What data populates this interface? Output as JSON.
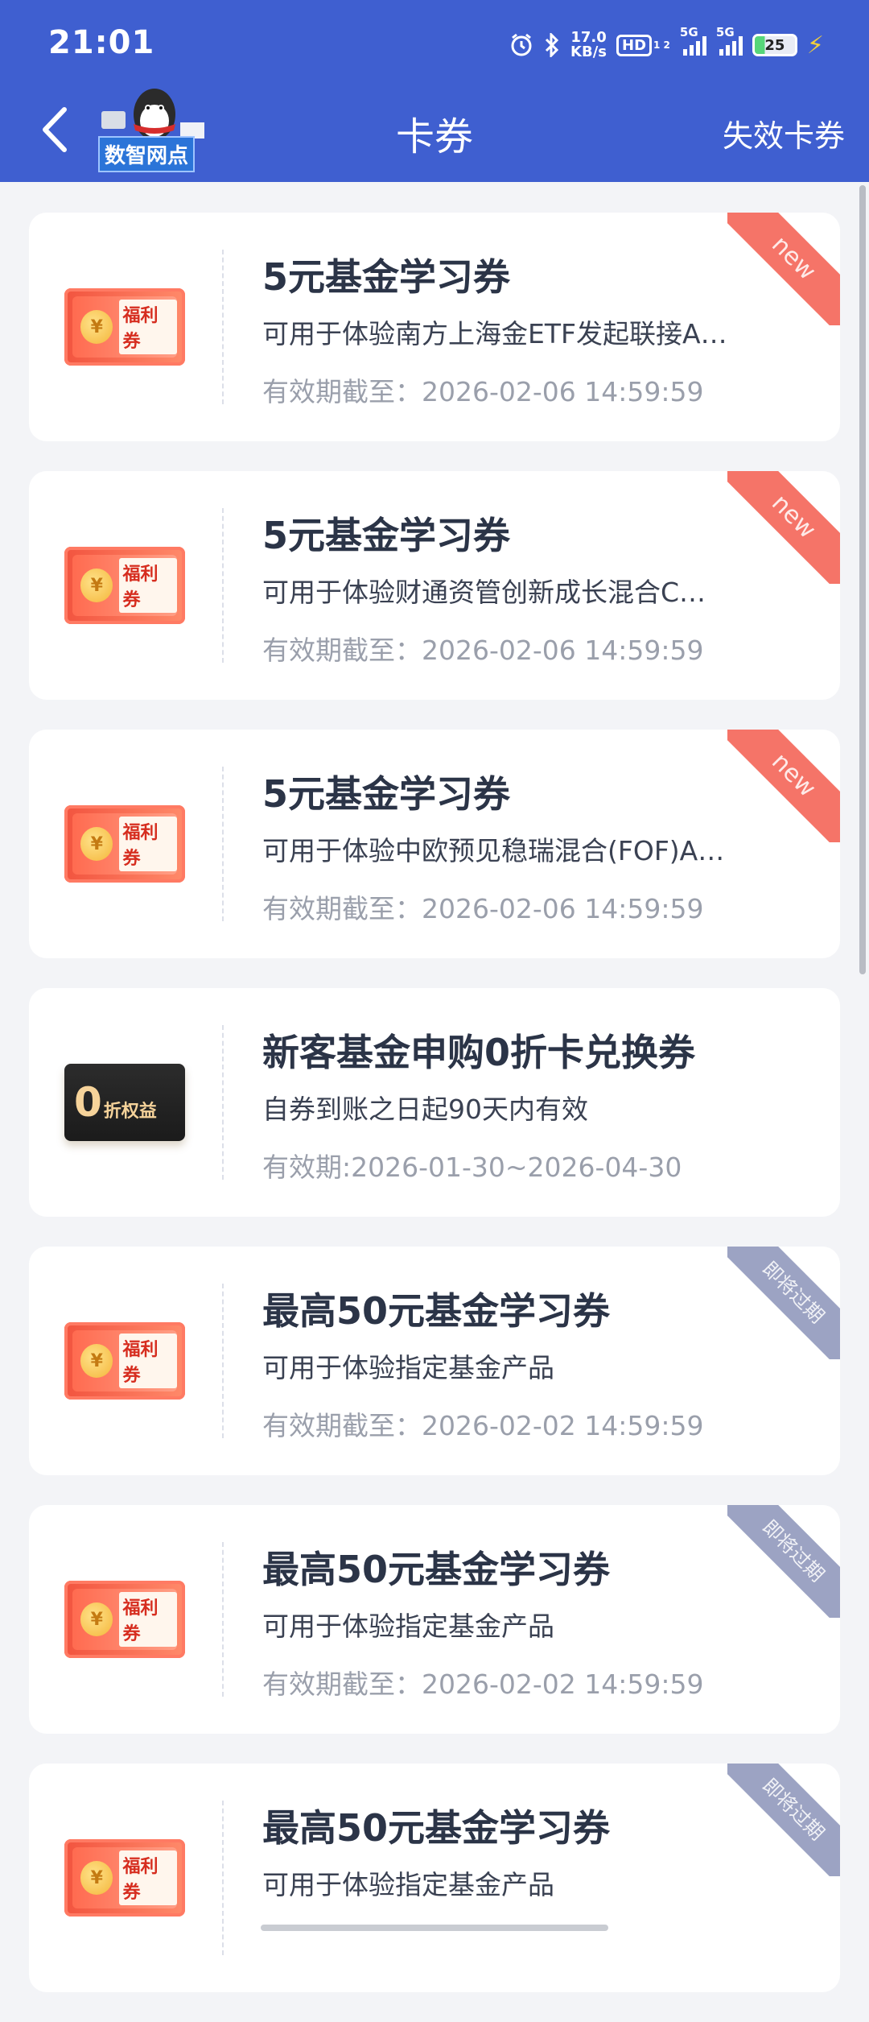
{
  "status_bar": {
    "time": "21:01",
    "net_speed_value": "17.0",
    "net_speed_unit": "KB/s",
    "hd_label": "HD",
    "hd_sub": "1 2",
    "signal_1_label": "5G",
    "signal_2_label": "5G",
    "battery_level": "25"
  },
  "nav": {
    "title": "卡券",
    "right_action": "失效卡券",
    "mascot_label": "数智网点"
  },
  "cards": [
    {
      "title": "5元基金学习券",
      "desc": "可用于体验南方上海金ETF发起联接A…",
      "date": "有效期截至：2026-02-06 14:59:59",
      "tag": "new",
      "thumb_text": "福利券"
    },
    {
      "title": "5元基金学习券",
      "desc": "可用于体验财通资管创新成长混合C…",
      "date": "有效期截至：2026-02-06 14:59:59",
      "tag": "new",
      "thumb_text": "福利券"
    },
    {
      "title": "5元基金学习券",
      "desc": "可用于体验中欧预见稳瑞混合(FOF)A…",
      "date": "有效期截至：2026-02-06 14:59:59",
      "tag": "new",
      "thumb_text": "福利券"
    },
    {
      "title": "新客基金申购0折卡兑换券",
      "desc": "自券到账之日起90天内有效",
      "date": "有效期:2026-01-30~2026-04-30",
      "thumb_digit": "0",
      "thumb_text": "折权益"
    },
    {
      "title": "最高50元基金学习券",
      "desc": "可用于体验指定基金产品",
      "date": "有效期截至：2026-02-02 14:59:59",
      "tag": "即将过期",
      "thumb_text": "福利券"
    },
    {
      "title": "最高50元基金学习券",
      "desc": "可用于体验指定基金产品",
      "date": "有效期截至：2026-02-02 14:59:59",
      "tag": "即将过期",
      "thumb_text": "福利券"
    },
    {
      "title": "最高50元基金学习券",
      "desc": "可用于体验指定基金产品",
      "date": "",
      "tag": "即将过期",
      "thumb_text": "福利券"
    }
  ],
  "colors": {
    "header_bg": "#3f5fd0",
    "new_ribbon": "#f57468",
    "expire_ribbon": "#9ca3c3",
    "title_text": "#2b3447",
    "muted_text": "#9a9fab"
  },
  "icons": {
    "back": "chevron-left-icon",
    "alarm": "alarm-icon",
    "bluetooth": "bluetooth-icon",
    "charging": "bolt-icon",
    "coin": "coin-icon"
  }
}
